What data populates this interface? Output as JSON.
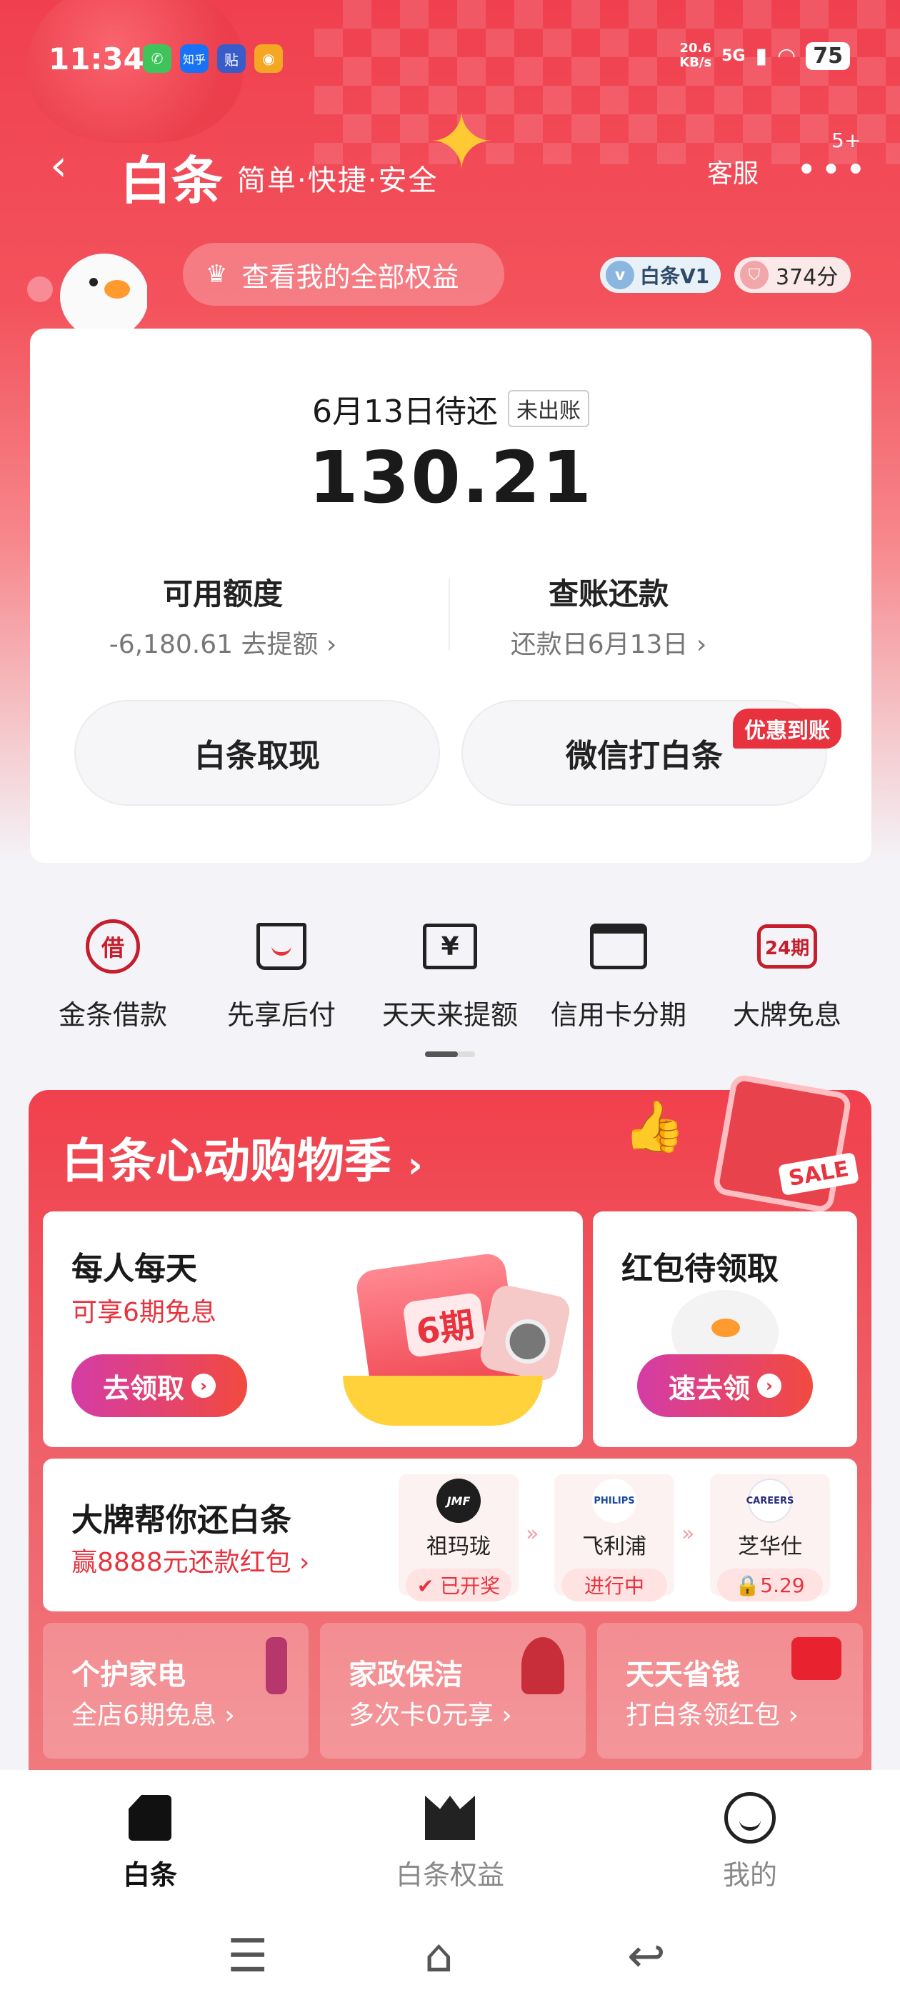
{
  "status_bar": {
    "time": "11:34",
    "apps": [
      {
        "name": "phone-app-icon",
        "glyph": "✆",
        "color": "#3ec45a"
      },
      {
        "name": "zhihu-app-icon",
        "glyph": "知乎",
        "color": "#1772f6"
      },
      {
        "name": "tieba-app-icon",
        "glyph": "贴",
        "color": "#3a5cc8"
      },
      {
        "name": "weibo-app-icon",
        "glyph": "◉",
        "color": "#f5a623"
      }
    ],
    "net_speed_value": "20.6",
    "net_speed_unit": "KB/s",
    "network": "5G",
    "battery": "75"
  },
  "nav": {
    "back_glyph": "‹",
    "title": "白条",
    "subtitle": "简单·快捷·安全",
    "customer_service": "客服",
    "more_glyph": "•••",
    "more_badge": "5+"
  },
  "header": {
    "benefits_label": "查看我的全部权益",
    "level_label": "白条V1",
    "level_glyph": "v",
    "score_label": "374分",
    "score_glyph": "⛉"
  },
  "bill_card": {
    "due_label": "6月13日待还",
    "unbilled_tag": "未出账",
    "due_amount": "130.21",
    "credit_title": "可用额度",
    "credit_sub": "-6,180.61 去提额 ›",
    "repay_title": "查账还款",
    "repay_sub": "还款日6月13日 ›",
    "cash_button": "白条取现",
    "wechat_button": "微信打白条",
    "promo_tag": "优惠到账"
  },
  "quick_actions": [
    {
      "label": "金条借款",
      "icon": "loan-icon",
      "glyph": "借"
    },
    {
      "label": "先享后付",
      "icon": "shopping-bag-icon",
      "glyph": ""
    },
    {
      "label": "天天来提额",
      "icon": "credit-raise-icon",
      "glyph": "¥"
    },
    {
      "label": "信用卡分期",
      "icon": "credit-card-icon",
      "glyph": ""
    },
    {
      "label": "大牌免息",
      "icon": "interest-free-icon",
      "glyph": "24期"
    }
  ],
  "promo": {
    "title": "白条心动购物季",
    "title_arrow": "›",
    "sale_tag": "SALE",
    "thumb_glyph": "👍",
    "card_daily": {
      "title": "每人每天",
      "subtitle": "可享6期免息",
      "button": "去领取",
      "envelope_label": "6期"
    },
    "card_redpacket": {
      "title": "红包待领取",
      "button": "速去领"
    },
    "card_brand": {
      "title": "大牌帮你还白条",
      "subtitle": "赢8888元还款红包 ›",
      "brands": [
        {
          "logo": "JMF",
          "name": "祖玛珑",
          "status": "✔ 已开奖"
        },
        {
          "logo": "PHILIPS",
          "name": "飞利浦",
          "status": "进行中"
        },
        {
          "logo": "CAREERS",
          "name": "芝华仕",
          "status": "🔒5.29"
        }
      ]
    },
    "minis": [
      {
        "title": "个护家电",
        "subtitle": "全店6期免息 ›"
      },
      {
        "title": "家政保洁",
        "subtitle": "多次卡0元享 ›"
      },
      {
        "title": "天天省钱",
        "subtitle": "打白条领红包 ›"
      }
    ]
  },
  "tab_bar": {
    "tabs": [
      {
        "label": "白条",
        "icon": "bill-icon"
      },
      {
        "label": "白条权益",
        "icon": "crown-icon"
      },
      {
        "label": "我的",
        "icon": "face-icon"
      }
    ]
  },
  "system_nav": {
    "menu_glyph": "☰",
    "home_glyph": "⌂",
    "back_glyph": "↩"
  }
}
